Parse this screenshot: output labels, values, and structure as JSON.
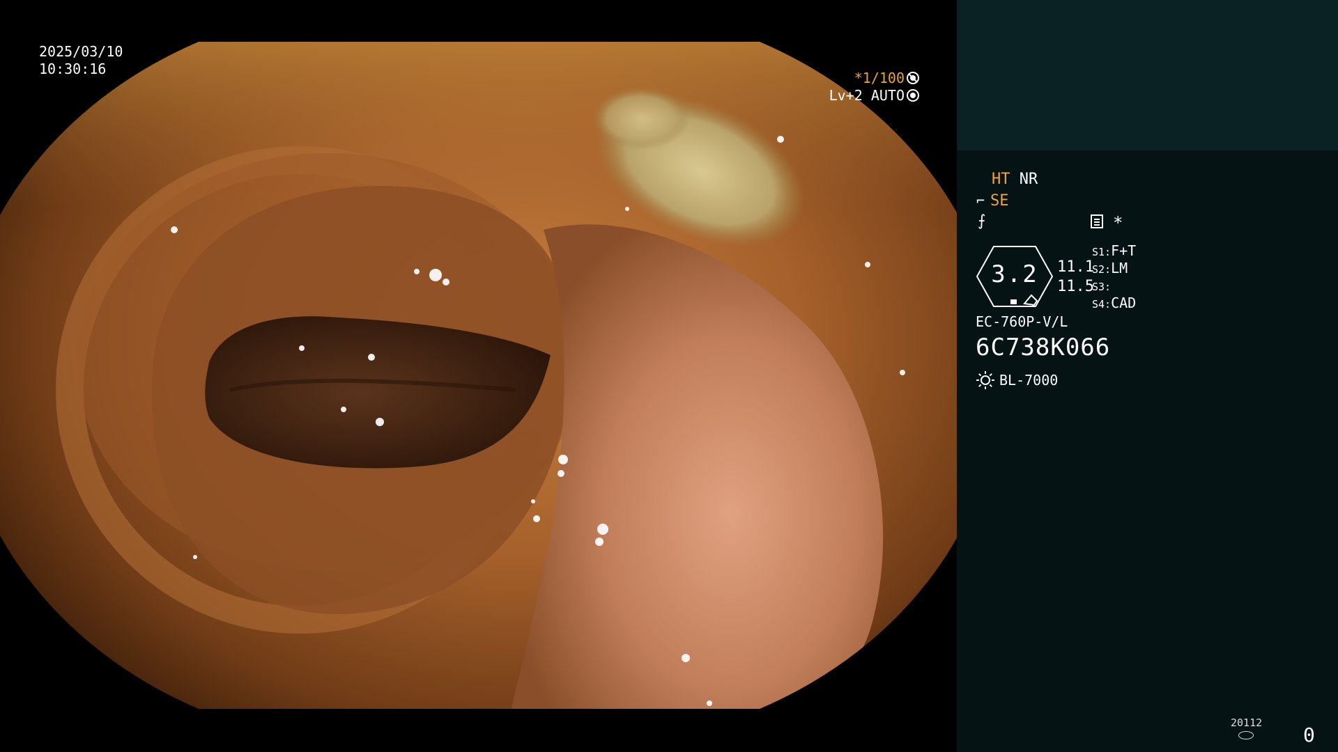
{
  "overlay": {
    "date": "2025/03/10",
    "time": "10:30:16",
    "shutter_prefix": "*",
    "shutter_speed": "1/100",
    "level": "Lv+2",
    "iris_mode": "AUTO"
  },
  "panel": {
    "mode_accent": "HT",
    "mode_text": "NR",
    "structure_enhance": "SE",
    "slash_symbol": "⨍",
    "star": "*",
    "enhance_value": "3.2",
    "value_1": "11.1",
    "value_2": "11.5",
    "slots": [
      {
        "key": "S1:",
        "value": "F+T"
      },
      {
        "key": "S2:",
        "value": "LM"
      },
      {
        "key": "S3:",
        "value": ""
      },
      {
        "key": "S4:",
        "value": "CAD"
      }
    ],
    "scope_model": "EC-760P-V/L",
    "scope_serial": "6C738K066",
    "light_source": "BL-7000",
    "footer_number": "20112",
    "footer_count": "0"
  },
  "colors": {
    "accent": "#f0a43c",
    "panel_bg": "#061314",
    "panel_top_bg": "#0b2225"
  },
  "icons": {
    "shutter_symbol": "aperture-icon",
    "iris_symbol": "iris-icon",
    "record": "record-icon",
    "light": "sun-icon",
    "storage": "disk-icon"
  }
}
